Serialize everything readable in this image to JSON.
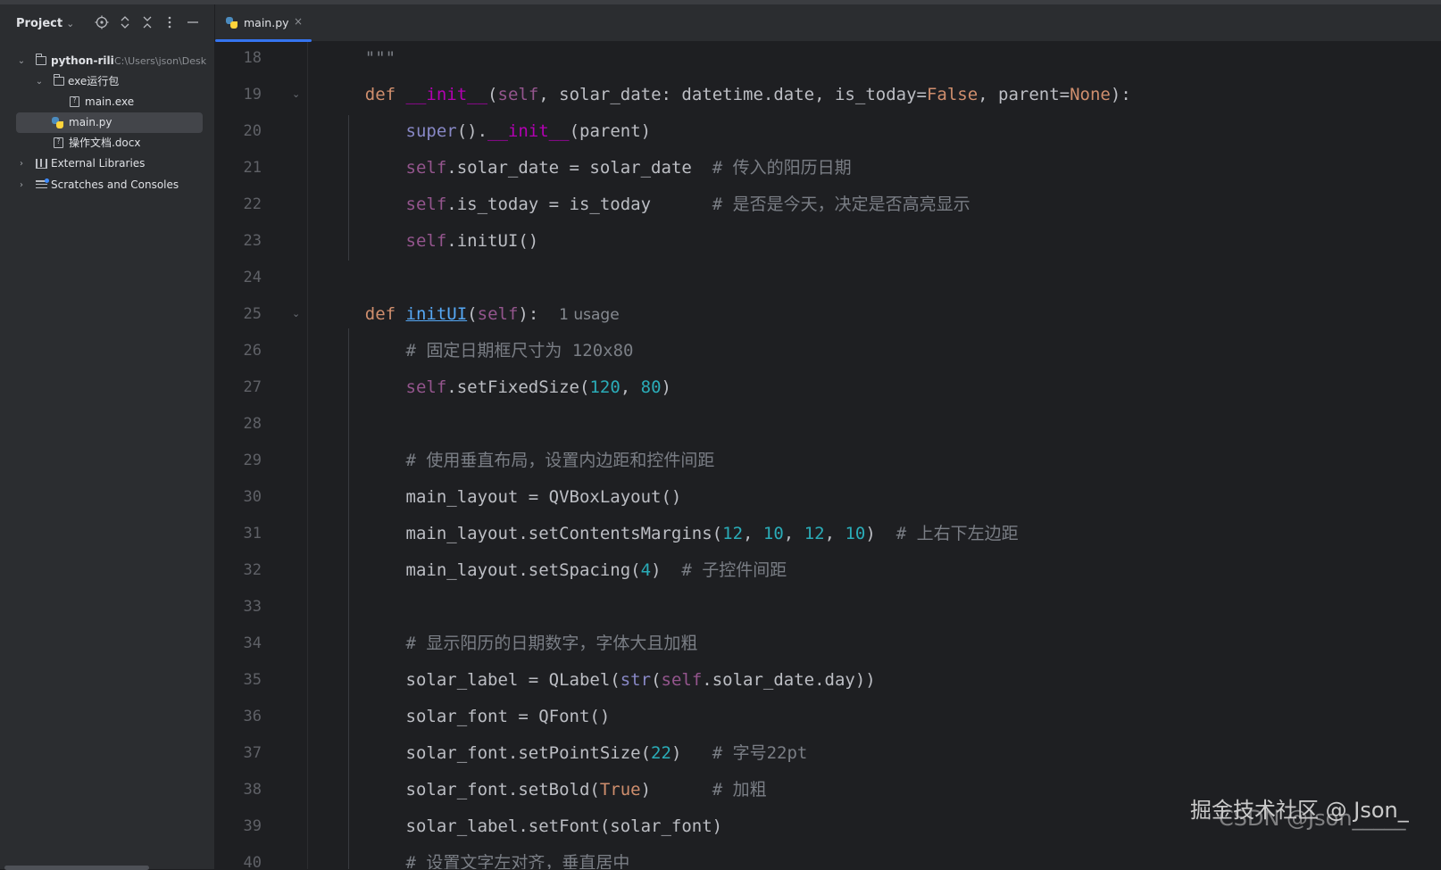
{
  "sidebar": {
    "title": "Project",
    "title_chevron": "⌄",
    "tools": [
      "locate-icon",
      "expand-all-icon",
      "collapse-all-icon",
      "options-icon",
      "hide-icon"
    ],
    "tree": [
      {
        "label": "python-rili",
        "path": "C:\\Users\\json\\Desk",
        "icon": "folder-icon"
      },
      {
        "label": "exe运行包",
        "icon": "folder-icon"
      },
      {
        "label": "main.exe",
        "icon": "unknown-file-icon"
      },
      {
        "label": "main.py",
        "icon": "python-file-icon",
        "selected": true
      },
      {
        "label": "操作文档.docx",
        "icon": "unknown-file-icon"
      },
      {
        "label": "External Libraries",
        "icon": "library-icon"
      },
      {
        "label": "Scratches and Consoles",
        "icon": "scratches-icon"
      }
    ]
  },
  "tabs": [
    {
      "label": "main.py",
      "close": "×",
      "active": true
    }
  ],
  "editor": {
    "lines": [
      {
        "n": "18",
        "tokens": [
          [
            "",
            "    "
          ],
          [
            "cm",
            "\"\"\""
          ]
        ]
      },
      {
        "n": "19",
        "fold": true,
        "tokens": [
          [
            "",
            "    "
          ],
          [
            "kw",
            "def "
          ],
          [
            "mag",
            "__init__"
          ],
          [
            "",
            "("
          ],
          [
            "self",
            "self"
          ],
          [
            "",
            ", solar_date: datetime.date, is_today="
          ],
          [
            "kw",
            "False"
          ],
          [
            "",
            ", parent="
          ],
          [
            "kw",
            "None"
          ],
          [
            "",
            "):"
          ]
        ]
      },
      {
        "n": "20",
        "tokens": [
          [
            "",
            "        "
          ],
          [
            "bi",
            "super"
          ],
          [
            "",
            "()."
          ],
          [
            "mag",
            "__init__"
          ],
          [
            "",
            "(parent)"
          ]
        ]
      },
      {
        "n": "21",
        "tokens": [
          [
            "",
            "        "
          ],
          [
            "self",
            "self"
          ],
          [
            "",
            ".solar_date = solar_date  "
          ],
          [
            "cm",
            "# 传入的阳历日期"
          ]
        ]
      },
      {
        "n": "22",
        "tokens": [
          [
            "",
            "        "
          ],
          [
            "self",
            "self"
          ],
          [
            "",
            ".is_today = is_today      "
          ],
          [
            "cm",
            "# 是否是今天，决定是否高亮显示"
          ]
        ]
      },
      {
        "n": "23",
        "tokens": [
          [
            "",
            "        "
          ],
          [
            "self",
            "self"
          ],
          [
            "",
            ".initUI()"
          ]
        ]
      },
      {
        "n": "24",
        "tokens": []
      },
      {
        "n": "25",
        "fold": true,
        "tokens": [
          [
            "",
            "    "
          ],
          [
            "kw",
            "def "
          ],
          [
            "fn uline",
            "initUI"
          ],
          [
            "",
            "("
          ],
          [
            "self",
            "self"
          ],
          [
            "",
            "):  "
          ],
          [
            "hint",
            "1 usage"
          ]
        ]
      },
      {
        "n": "26",
        "tokens": [
          [
            "",
            "        "
          ],
          [
            "cm",
            "# 固定日期框尺寸为 120x80"
          ]
        ]
      },
      {
        "n": "27",
        "tokens": [
          [
            "",
            "        "
          ],
          [
            "self",
            "self"
          ],
          [
            "",
            ".setFixedSize("
          ],
          [
            "num",
            "120"
          ],
          [
            "",
            ", "
          ],
          [
            "num",
            "80"
          ],
          [
            "",
            ")"
          ]
        ]
      },
      {
        "n": "28",
        "tokens": []
      },
      {
        "n": "29",
        "tokens": [
          [
            "",
            "        "
          ],
          [
            "cm",
            "# 使用垂直布局，设置内边距和控件间距"
          ]
        ]
      },
      {
        "n": "30",
        "tokens": [
          [
            "",
            "        main_layout = QVBoxLayout()"
          ]
        ]
      },
      {
        "n": "31",
        "tokens": [
          [
            "",
            "        main_layout.setContentsMargins("
          ],
          [
            "num",
            "12"
          ],
          [
            "",
            ", "
          ],
          [
            "num",
            "10"
          ],
          [
            "",
            ", "
          ],
          [
            "num",
            "12"
          ],
          [
            "",
            ", "
          ],
          [
            "num",
            "10"
          ],
          [
            "",
            ")  "
          ],
          [
            "cm",
            "# 上右下左边距"
          ]
        ]
      },
      {
        "n": "32",
        "tokens": [
          [
            "",
            "        main_layout.setSpacing("
          ],
          [
            "num",
            "4"
          ],
          [
            "",
            ")  "
          ],
          [
            "cm",
            "# 子控件间距"
          ]
        ]
      },
      {
        "n": "33",
        "tokens": []
      },
      {
        "n": "34",
        "tokens": [
          [
            "",
            "        "
          ],
          [
            "cm",
            "# 显示阳历的日期数字，字体大且加粗"
          ]
        ]
      },
      {
        "n": "35",
        "tokens": [
          [
            "",
            "        solar_label = QLabel("
          ],
          [
            "bi",
            "str"
          ],
          [
            "",
            "("
          ],
          [
            "self",
            "self"
          ],
          [
            "",
            ".solar_date.day))"
          ]
        ]
      },
      {
        "n": "36",
        "tokens": [
          [
            "",
            "        solar_font = QFont()"
          ]
        ]
      },
      {
        "n": "37",
        "tokens": [
          [
            "",
            "        solar_font.setPointSize("
          ],
          [
            "num",
            "22"
          ],
          [
            "",
            ")   "
          ],
          [
            "cm",
            "# 字号22pt"
          ]
        ]
      },
      {
        "n": "38",
        "tokens": [
          [
            "",
            "        solar_font.setBold("
          ],
          [
            "kw",
            "True"
          ],
          [
            "",
            ")      "
          ],
          [
            "cm",
            "# 加粗"
          ]
        ]
      },
      {
        "n": "39",
        "tokens": [
          [
            "",
            "        solar_label.setFont(solar_font)"
          ]
        ]
      },
      {
        "n": "40",
        "tokens": [
          [
            "",
            "        "
          ],
          [
            "cm",
            "# 设置文字左对齐，垂直居中"
          ]
        ]
      }
    ]
  },
  "watermark": {
    "line1": "掘金技术社区 @ Json_",
    "line2": "CSDN @Json_____"
  }
}
